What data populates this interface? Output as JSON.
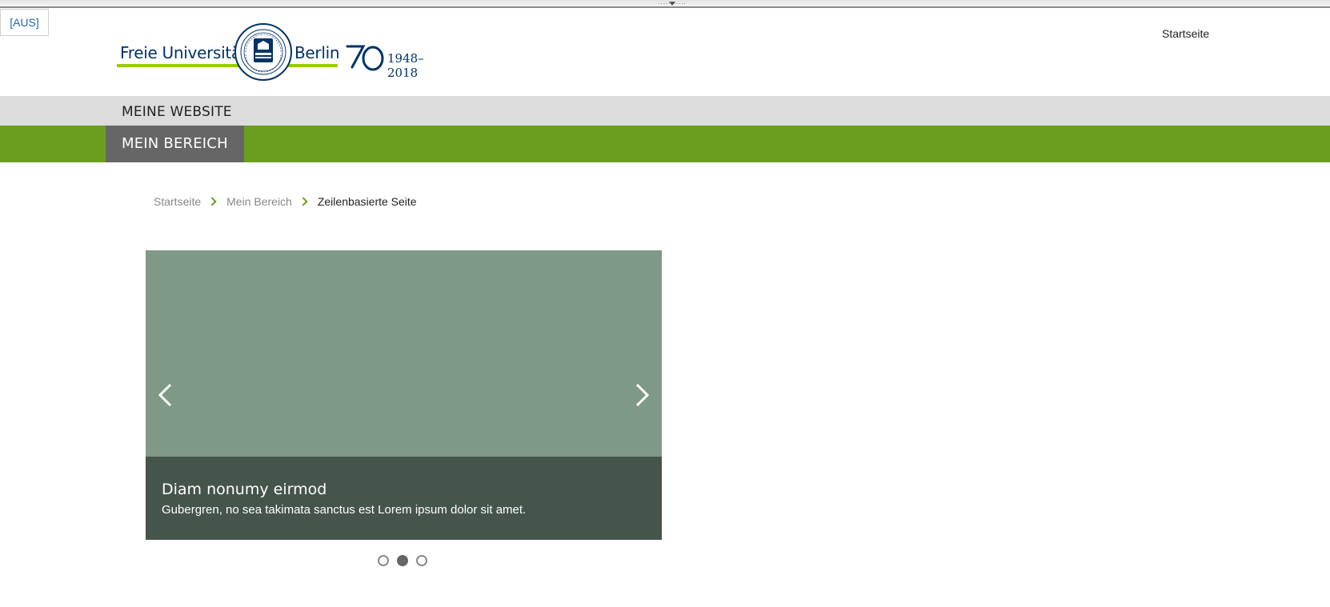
{
  "toolbar": {
    "toggle_label": "[AUS]"
  },
  "header": {
    "logo": {
      "name_left": "Freie Universität",
      "name_right": "Berlin",
      "anniversary_years": "1948–2018",
      "seal_icon": "university-seal-icon",
      "anniversary_icon": "seventy-anniversary-icon"
    },
    "service_link": "Startseite"
  },
  "site": {
    "title": "MEINE WEBSITE"
  },
  "nav": {
    "items": [
      {
        "label": "MEIN BEREICH",
        "active": true
      }
    ]
  },
  "breadcrumb": {
    "items": [
      "Startseite",
      "Mein Bereich"
    ],
    "current": "Zeilenbasierte Seite"
  },
  "slider": {
    "slide": {
      "title": "Diam nonumy eirmod",
      "text": "Gubergren, no sea takimata sanctus est Lorem ipsum dolor sit amet."
    },
    "slide_count": 3,
    "active_index": 1,
    "prev_icon": "chevron-left-icon",
    "next_icon": "chevron-right-icon"
  },
  "colors": {
    "brand_green": "#6b9e1f",
    "logo_green": "#99cc00",
    "logo_blue": "#003366",
    "nav_active": "#666666",
    "slide_bg": "#7f9988",
    "caption_bg": "#45554b",
    "link_blue": "#1e66b0"
  }
}
